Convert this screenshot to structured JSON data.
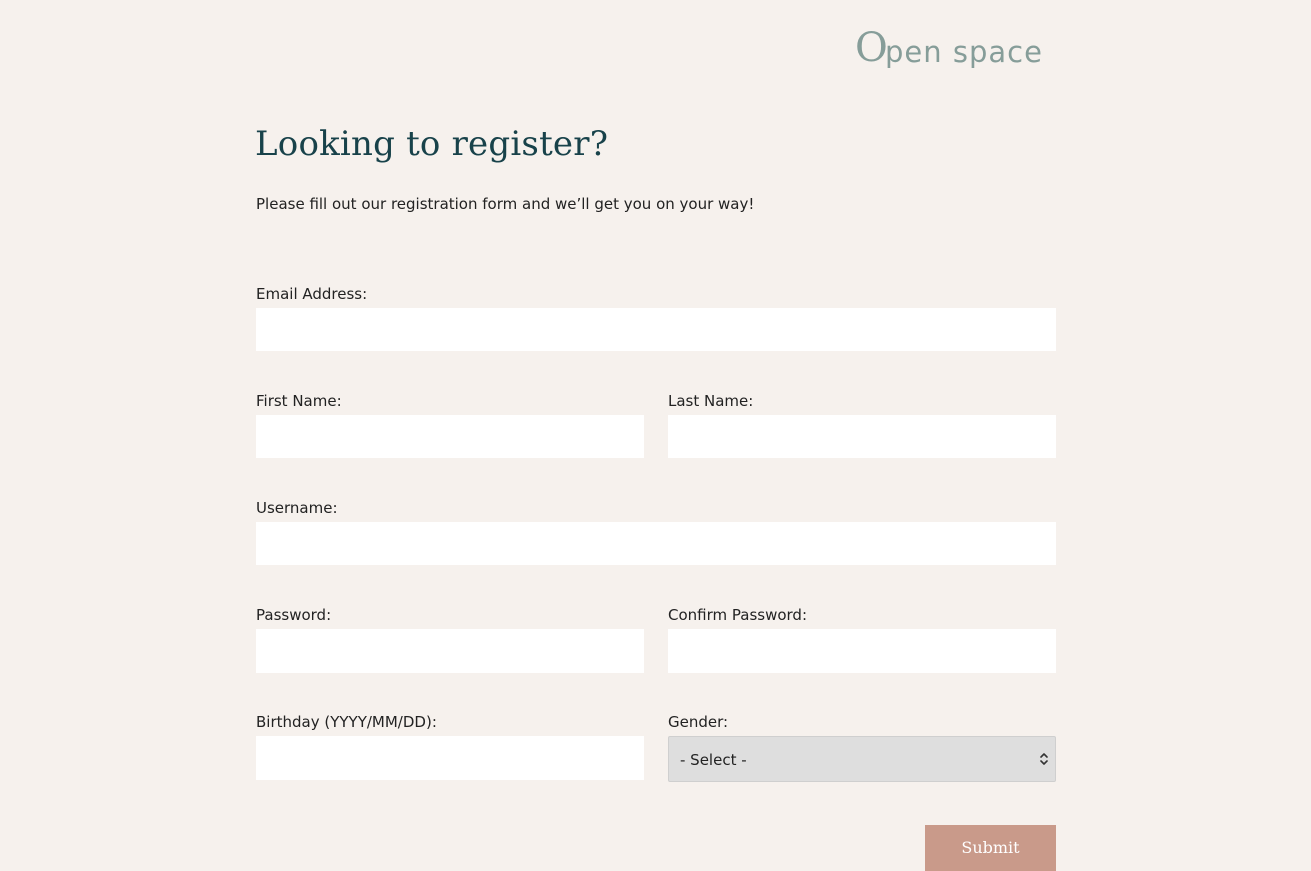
{
  "brand": {
    "logo_initial": "O",
    "logo_rest": "pen space",
    "logo_color": "#869d99"
  },
  "page": {
    "title": "Looking to register?",
    "intro": "Please fill out our registration form and we’ll get you on your way!"
  },
  "form": {
    "email_label": "Email Address:",
    "email_value": "",
    "first_name_label": "First Name:",
    "first_name_value": "",
    "last_name_label": "Last Name:",
    "last_name_value": "",
    "username_label": "Username:",
    "username_value": "",
    "password_label": "Password:",
    "password_value": "",
    "confirm_password_label": "Confirm Password:",
    "confirm_password_value": "",
    "birthday_label": "Birthday (YYYY/MM/DD):",
    "birthday_value": "",
    "gender_label": "Gender:",
    "gender_selected": "- Select -",
    "submit_label": "Submit"
  },
  "colors": {
    "background": "#f6f1ed",
    "heading": "#18424a",
    "submit": "#c99a8a",
    "select_bg": "#dedede"
  }
}
